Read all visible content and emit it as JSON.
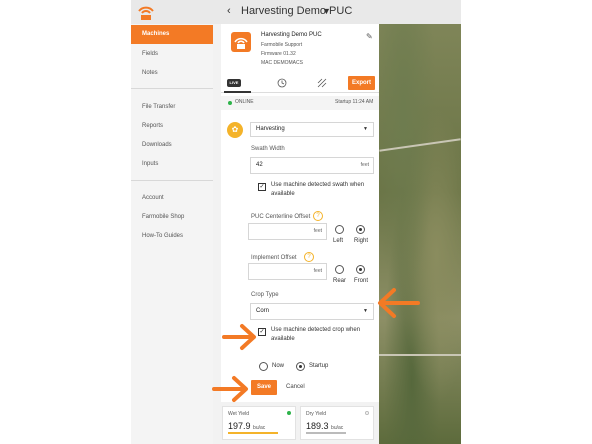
{
  "header": {
    "title": "Harvesting Demo PUC"
  },
  "sidebar": {
    "items": [
      {
        "label": "Machines",
        "active": true
      },
      {
        "label": "Fields"
      },
      {
        "label": "Notes"
      },
      {
        "label": "File Transfer"
      },
      {
        "label": "Reports"
      },
      {
        "label": "Downloads"
      },
      {
        "label": "Inputs"
      },
      {
        "label": "Account"
      },
      {
        "label": "Farmobile Shop"
      },
      {
        "label": "How-To Guides"
      }
    ]
  },
  "device": {
    "name": "Harvesting Demo PUC",
    "support": "Farmobile Support",
    "firmware": "Firmware 01.32",
    "mac": "MAC DEMOMACS"
  },
  "tabs": {
    "live": "LIVE",
    "export": "Export"
  },
  "status": {
    "online": "ONLINE",
    "startup": "Startup 11:24 AM"
  },
  "operation": {
    "selected": "Harvesting"
  },
  "swath": {
    "label": "Swath Width",
    "value": "42",
    "unit": "feet",
    "checkbox_label": "Use machine detected swath when available",
    "checked": true
  },
  "puc_offset": {
    "label": "PUC Centerline Offset",
    "unit": "feet",
    "left": "Left",
    "right": "Right",
    "selected": "Right"
  },
  "implement_offset": {
    "label": "Implement Offset",
    "unit": "feet",
    "rear": "Rear",
    "front": "Front",
    "selected": "Front"
  },
  "crop": {
    "label": "Crop Type",
    "selected": "Corn",
    "checkbox_label": "Use machine detected crop when available",
    "checked": true
  },
  "apply": {
    "now": "Now",
    "startup": "Startup",
    "selected": "Startup"
  },
  "buttons": {
    "save": "Save",
    "cancel": "Cancel"
  },
  "yields": [
    {
      "title": "Wet Yield",
      "value": "197.9",
      "unit": "bu/ac",
      "dot_color": "#2db34a"
    },
    {
      "title": "Dry Yield",
      "value": "189.3",
      "unit": "bu/ac",
      "dot_color": "#bbbbbb"
    }
  ],
  "colors": {
    "accent": "#f37a25",
    "online": "#2db34a",
    "help": "#f4b32a"
  }
}
